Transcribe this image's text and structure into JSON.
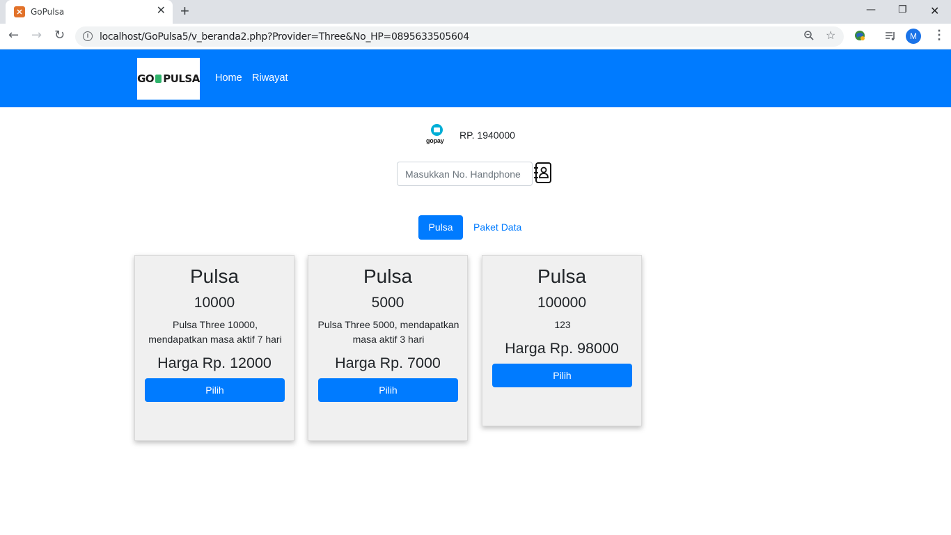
{
  "browser": {
    "tab_title": "GoPulsa",
    "url": "localhost/GoPulsa5/v_beranda2.php?Provider=Three&No_HP=0895633505604",
    "profile_initial": "M"
  },
  "navbar": {
    "brand_left": "GO",
    "brand_right": "PULSA",
    "links": [
      "Home",
      "Riwayat"
    ]
  },
  "wallet": {
    "logo_text": "gopay",
    "balance": "RP. 1940000"
  },
  "phone_input": {
    "value": "",
    "placeholder": "Masukkan No. Handphone"
  },
  "tabs": {
    "active": "Pulsa",
    "other": "Paket Data"
  },
  "products": [
    {
      "title": "Pulsa",
      "nominal": "10000",
      "description": "Pulsa Three 10000, mendapatkan masa aktif 7 hari",
      "price": "Harga Rp. 12000",
      "button": "Pilih"
    },
    {
      "title": "Pulsa",
      "nominal": "5000",
      "description": "Pulsa Three 5000, mendapatkan masa aktif 3 hari",
      "price": "Harga Rp. 7000",
      "button": "Pilih"
    },
    {
      "title": "Pulsa",
      "nominal": "100000",
      "description": "123",
      "price": "Harga Rp. 98000",
      "button": "Pilih"
    }
  ],
  "colors": {
    "primary": "#007bff",
    "card_bg": "#f0f0f0",
    "gopay": "#00aed6"
  }
}
